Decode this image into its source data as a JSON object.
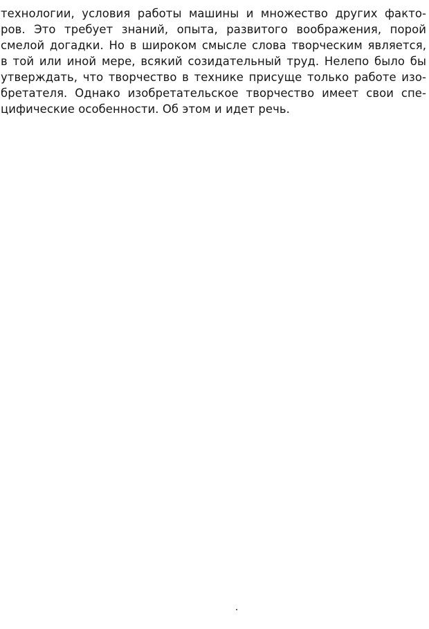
{
  "document": {
    "lines": [
      "технологии, условия  работы машины  и множество других  факто-",
      "ров. Это требует знаний, опыта,  развитого  воображения,  порой",
      "смелой догадки. Но в широком смысле слова творческим является,",
      "в той или иной мере, всякий созидательный труд. Нелепо было бы",
      "утверждать, что творчество в технике присуще только работе изо-",
      "бретателя. Однако изобретательское творчество имеет свои спе-",
      "цифические особенности. Об этом и идет речь."
    ]
  }
}
